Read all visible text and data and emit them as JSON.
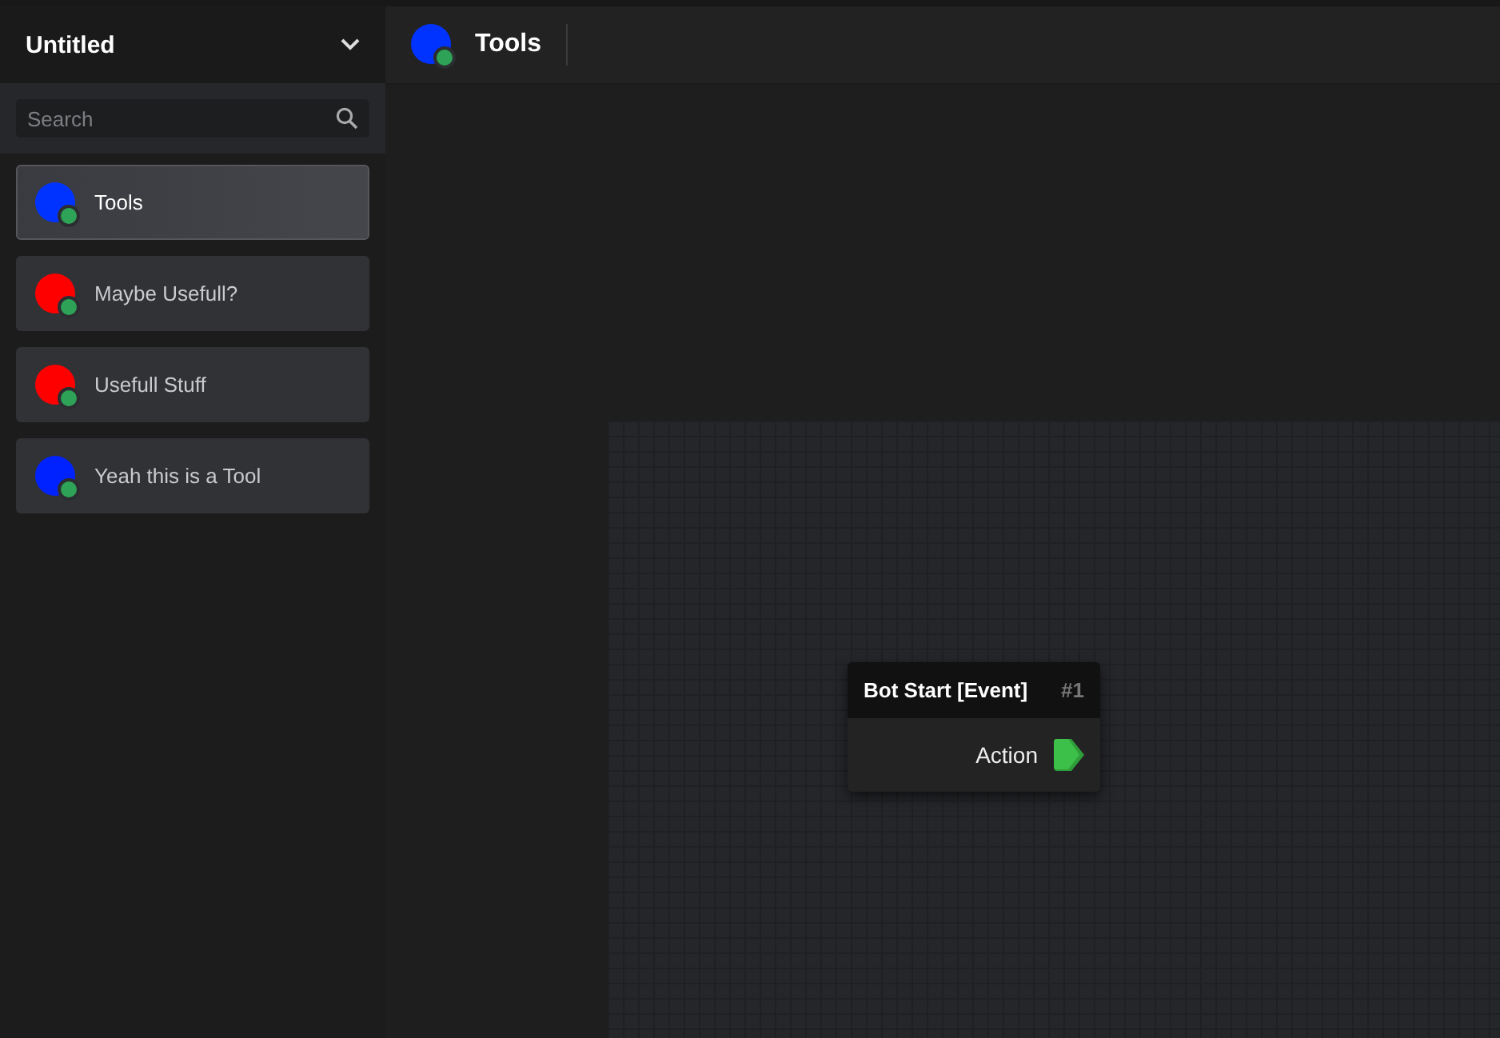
{
  "workspace": {
    "title": "Untitled"
  },
  "search": {
    "placeholder": "Search"
  },
  "sidebar": {
    "items": [
      {
        "label": "Tools",
        "color": "#0033ff",
        "selected": true
      },
      {
        "label": "Maybe Usefull?",
        "color": "#ff0000",
        "selected": false
      },
      {
        "label": "Usefull Stuff",
        "color": "#ff0000",
        "selected": false
      },
      {
        "label": "Yeah this is a Tool",
        "color": "#0022ff",
        "selected": false
      }
    ]
  },
  "header": {
    "title": "Tools",
    "color": "#0033ff"
  },
  "canvas": {
    "nodes": [
      {
        "title": "Bot Start [Event]",
        "number": "#1",
        "outputs": [
          "Action"
        ]
      }
    ]
  }
}
